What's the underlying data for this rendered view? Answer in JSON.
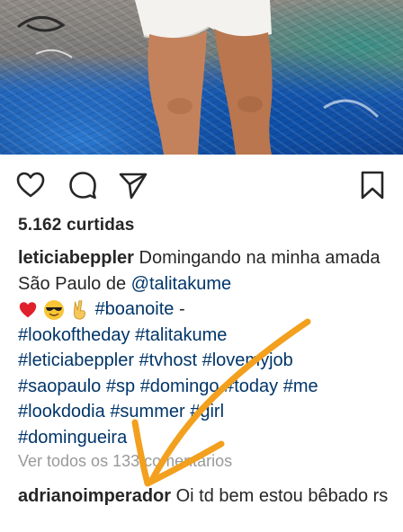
{
  "post": {
    "likes_text": "5.162 curtidas",
    "caption": {
      "username": "leticiabeppler",
      "text_1": "Domingando na minha amada São Paulo de",
      "mention": "@talitakume",
      "emojis": [
        "heart",
        "sunglasses-face",
        "victory-hand"
      ],
      "hashtags_line_1": "#boanoite",
      "dash": "-",
      "hashtags": [
        "#lookoftheday",
        "#talitakume",
        "#leticiabeppler",
        "#tvhost",
        "#lovemyjob",
        "#saopaulo",
        "#sp",
        "#domingo",
        "#today",
        "#me",
        "#lookdodia",
        "#summer",
        "#girl",
        "#domingueira"
      ]
    },
    "view_all_comments": "Ver todos os 133 comentários",
    "comment": {
      "username": "adrianoimperador",
      "text": "Oi td bem estou bêbado rs"
    }
  },
  "icons": {
    "like": "heart-outline-icon",
    "comment": "speech-bubble-icon",
    "share": "paper-plane-icon",
    "save": "bookmark-icon"
  },
  "colors": {
    "text": "#262626",
    "hashtag": "#003569",
    "muted": "#999999",
    "annotation_arrow": "#F2A01E"
  }
}
